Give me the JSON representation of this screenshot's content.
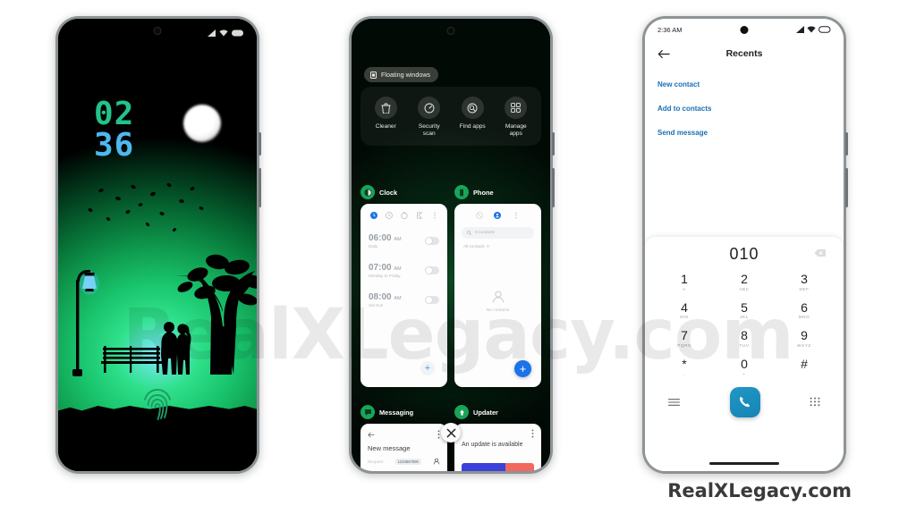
{
  "page": {
    "watermark": "RealXLegacy.com",
    "brand": "RealXLegacy.com",
    "background": "#ffffff"
  },
  "phone1": {
    "name": "lockscreen-phone",
    "statusbar": {
      "signal": "signal-icon",
      "wifi": "wifi-icon",
      "battery": "battery-icon"
    },
    "clock": {
      "hours": "02",
      "minutes": "36",
      "hours_color": "#22c38a",
      "minutes_color": "#4db8f0"
    },
    "wallpaper": {
      "description": "couple-silhouette-park-scene",
      "elements": [
        "moon",
        "tree",
        "lamp-post",
        "park-bench",
        "couple",
        "falling-leaves",
        "grass"
      ],
      "gradient_colors": [
        "#7fe8ff",
        "#2fe08a",
        "#0f9a4e",
        "#02361a",
        "#000000"
      ]
    },
    "fingerprint": {
      "label": "fingerprint-unlock",
      "color": "#1f8f5f"
    }
  },
  "phone2": {
    "name": "recents-phone",
    "floating_windows_chip": "Floating windows",
    "quick_actions": [
      {
        "label": "Cleaner",
        "icon": "trash-icon"
      },
      {
        "label": "Security\nscan",
        "line1": "Security",
        "line2": "scan",
        "icon": "speedometer-icon"
      },
      {
        "label": "Find apps",
        "line1": "Find apps",
        "line2": "",
        "icon": "search-icon"
      },
      {
        "label": "Manage\napps",
        "line1": "Manage",
        "line2": "apps",
        "icon": "grid-icon"
      }
    ],
    "cards": [
      {
        "app": "Clock",
        "icon_color": "#18a558",
        "alarms": [
          {
            "time": "06:00",
            "meridiem": "AM",
            "repeat": "Daily",
            "enabled": false
          },
          {
            "time": "07:00",
            "meridiem": "AM",
            "repeat": "Monday to Friday",
            "enabled": false
          },
          {
            "time": "08:00",
            "meridiem": "AM",
            "repeat": "Sat Sun",
            "enabled": false
          }
        ],
        "fab": "+"
      },
      {
        "app": "Phone",
        "icon_color": "#18a558",
        "search_placeholder": "0 contacts",
        "all_contacts_label": "All contacts",
        "all_contacts_count": "0",
        "empty_label": "No contacts",
        "fab": "+"
      },
      {
        "app": "Messaging",
        "icon_color": "#18a558",
        "title": "New message",
        "recipient_label": "Recipient",
        "recipient_value": "1234567890"
      },
      {
        "app": "Updater",
        "icon_color": "#18a558",
        "title": "An update is available"
      }
    ],
    "close_button": "close-icon"
  },
  "phone3": {
    "name": "dialer-phone",
    "statusbar": {
      "time": "2:36 AM",
      "signal": "signal-icon",
      "wifi": "wifi-icon",
      "battery": "battery-icon"
    },
    "header": {
      "back": "back-arrow-icon",
      "title": "Recents"
    },
    "links": [
      "New contact",
      "Add to contacts",
      "Send message"
    ],
    "link_color": "#1b6fb3",
    "dialer": {
      "number": "010",
      "backspace": "backspace-icon",
      "keys": [
        {
          "digit": "1",
          "sub": "∞"
        },
        {
          "digit": "2",
          "sub": "ABC"
        },
        {
          "digit": "3",
          "sub": "DEF"
        },
        {
          "digit": "4",
          "sub": "GHI"
        },
        {
          "digit": "5",
          "sub": "JKL"
        },
        {
          "digit": "6",
          "sub": "MNO"
        },
        {
          "digit": "7",
          "sub": "PQRS"
        },
        {
          "digit": "8",
          "sub": "TUV"
        },
        {
          "digit": "9",
          "sub": "WXYZ"
        },
        {
          "digit": "*",
          "sub": ","
        },
        {
          "digit": "0",
          "sub": "+"
        },
        {
          "digit": "#",
          "sub": ""
        }
      ],
      "menu_icon": "hamburger-menu-icon",
      "call_icon": "call-icon",
      "keypad_icon": "keypad-icon",
      "call_button_color": "#1b88b8"
    }
  }
}
